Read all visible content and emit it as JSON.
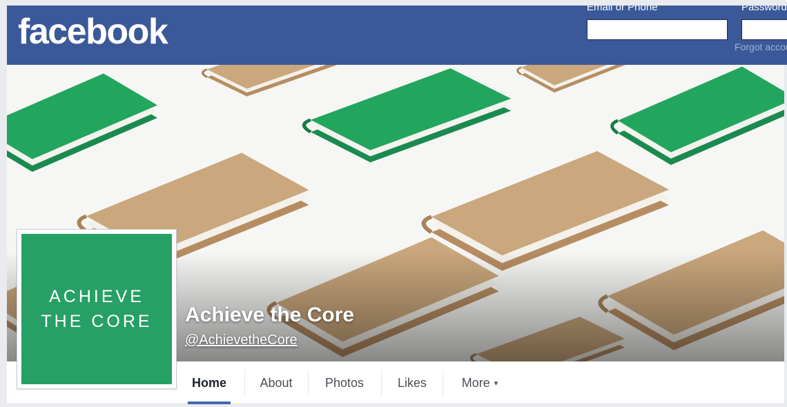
{
  "header": {
    "logo": "facebook",
    "email_label": "Email or Phone",
    "password_label": "Password",
    "email_value": "",
    "password_value": "",
    "forgot_label": "Forgot account?"
  },
  "page": {
    "name": "Achieve the Core",
    "handle": "@AchievetheCore",
    "profile_line1": "ACHIEVE",
    "profile_line2": "THE CORE"
  },
  "tabs": [
    {
      "label": "Home"
    },
    {
      "label": "About"
    },
    {
      "label": "Photos"
    },
    {
      "label": "Likes"
    },
    {
      "label": "More"
    }
  ],
  "more_caret": "▾",
  "colors": {
    "header_bg": "#3b5998",
    "brand_green": "#27a065",
    "book_tan": "#c9a67b",
    "book_green": "#1fa35d",
    "active_tab_underline": "#4267b2"
  }
}
